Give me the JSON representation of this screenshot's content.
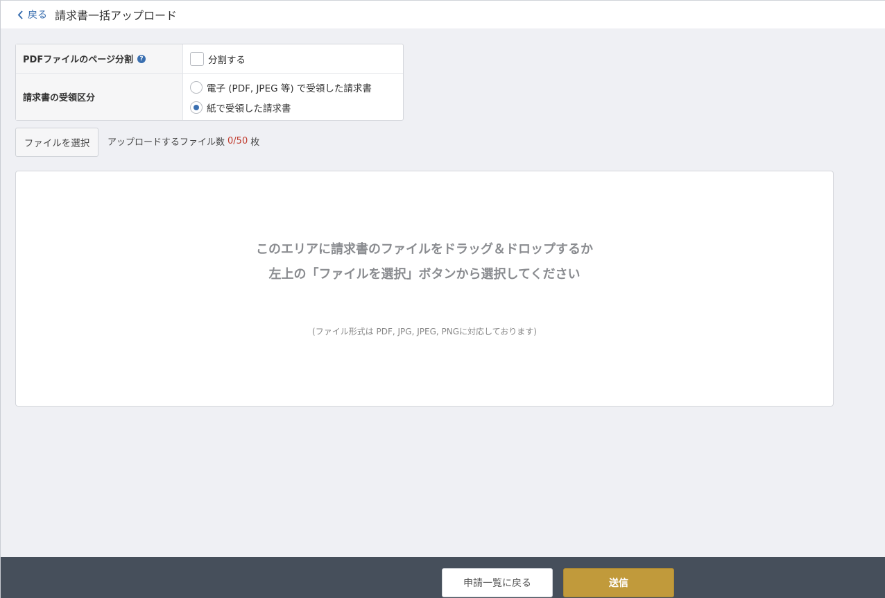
{
  "header": {
    "back_label": "戻る",
    "title": "請求書一括アップロード"
  },
  "settings": {
    "split": {
      "label": "PDFファイルのページ分割",
      "help_icon": "?",
      "option_label": "分割する",
      "checked": false
    },
    "receipt_type": {
      "label": "請求書の受領区分",
      "options": [
        {
          "label": "電子 (PDF, JPEG 等) で受領した請求書",
          "checked": false
        },
        {
          "label": "紙で受領した請求書",
          "checked": true
        }
      ]
    }
  },
  "file_select": {
    "button_label": "ファイルを選択",
    "count_prefix": "アップロードするファイル数",
    "count_value": "0/50",
    "count_suffix": "枚"
  },
  "dropzone": {
    "line1": "このエリアに請求書のファイルをドラッグ＆ドロップするか",
    "line2": "左上の「ファイルを選択」ボタンから選択してください",
    "note": "(ファイル形式は PDF, JPG, JPEG, PNGに対応しております)"
  },
  "footer": {
    "back_label": "申請一覧に戻る",
    "send_label": "送信"
  },
  "colors": {
    "accent": "#3a6fb0",
    "send_button": "#c19a3b",
    "footer_bg": "#464f5b",
    "count_highlight": "#c0392b"
  }
}
